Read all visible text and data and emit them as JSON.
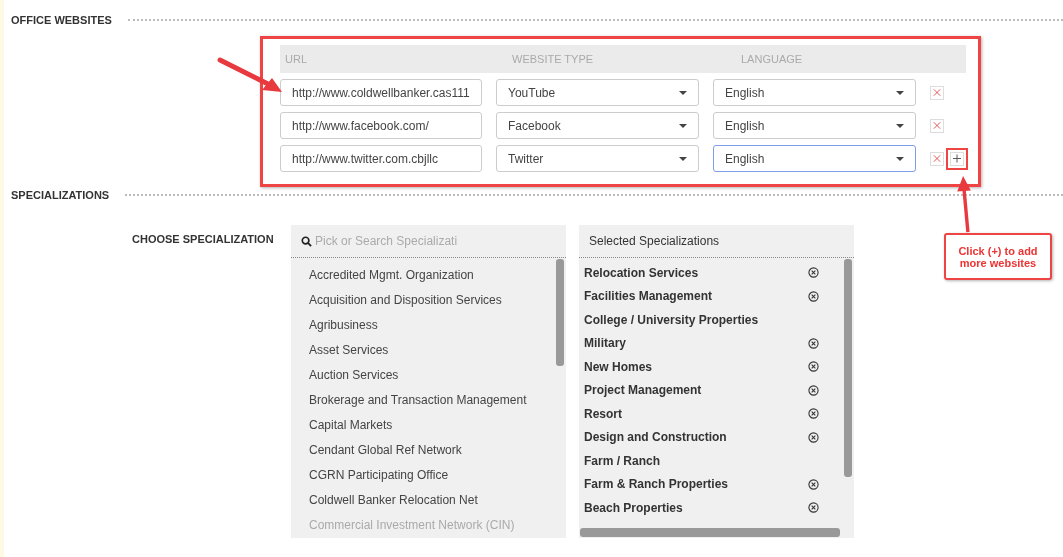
{
  "office_websites": {
    "heading": "OFFICE WEBSITES",
    "columns": [
      "URL",
      "WEBSITE TYPE",
      "LANGUAGE"
    ],
    "rows": [
      {
        "url": "http://www.coldwellbanker.cas111",
        "website_type": "YouTube",
        "language": "English",
        "focused": false,
        "last": false
      },
      {
        "url": "http://www.facebook.com/",
        "website_type": "Facebook",
        "language": "English",
        "focused": false,
        "last": false
      },
      {
        "url": "http://www.twitter.com.cbjllc",
        "website_type": "Twitter",
        "language": "English",
        "focused": true,
        "last": true
      }
    ]
  },
  "specializations": {
    "heading": "SPECIALIZATIONS",
    "label": "CHOOSE SPECIALIZATION",
    "search": {
      "placeholder": "Pick or Search Specializati"
    },
    "available": [
      {
        "name": "Accredited Mgmt. Organization",
        "disabled": false
      },
      {
        "name": "Acquisition and Disposition Services",
        "disabled": false
      },
      {
        "name": "Agribusiness",
        "disabled": false
      },
      {
        "name": "Asset Services",
        "disabled": false
      },
      {
        "name": "Auction Services",
        "disabled": false
      },
      {
        "name": "Brokerage and Transaction Management",
        "disabled": false
      },
      {
        "name": "Capital Markets",
        "disabled": false
      },
      {
        "name": "Cendant Global Ref Network",
        "disabled": false
      },
      {
        "name": "CGRN Participating Office",
        "disabled": false
      },
      {
        "name": "Coldwell Banker Relocation Net",
        "disabled": false
      },
      {
        "name": "Commercial Investment Network (CIN)",
        "disabled": true
      }
    ],
    "selected_title": "Selected Specializations",
    "selected": [
      {
        "name": "Relocation Services",
        "removable": true
      },
      {
        "name": "Facilities Management",
        "removable": true
      },
      {
        "name": "College / University Properties",
        "removable": false
      },
      {
        "name": "Military",
        "removable": true
      },
      {
        "name": "New Homes",
        "removable": true
      },
      {
        "name": "Project Management",
        "removable": true
      },
      {
        "name": "Resort",
        "removable": true
      },
      {
        "name": "Design and Construction",
        "removable": true
      },
      {
        "name": "Farm / Ranch",
        "removable": false
      },
      {
        "name": "Farm & Ranch Properties",
        "removable": true
      },
      {
        "name": "Beach Properties",
        "removable": true
      }
    ]
  },
  "callout": {
    "text": "Click (+) to add more websites"
  }
}
